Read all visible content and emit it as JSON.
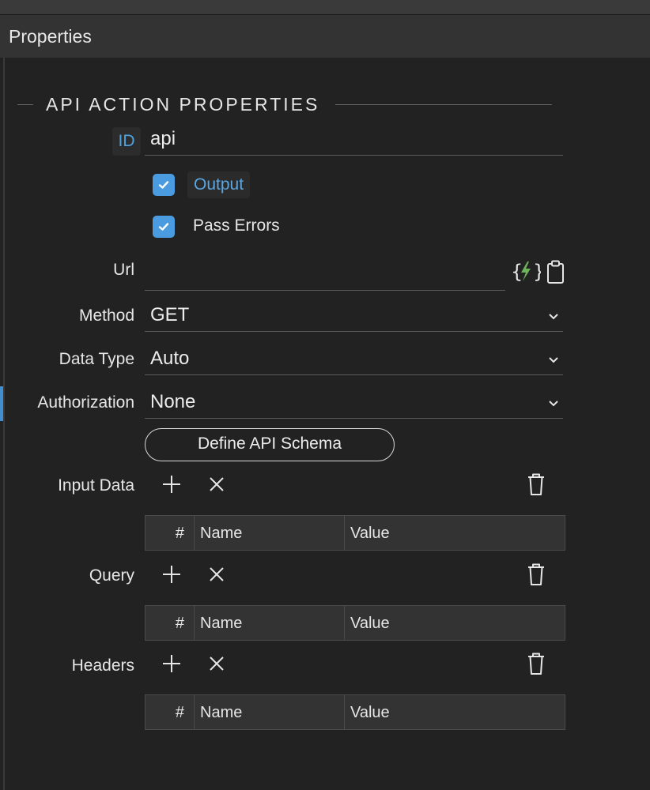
{
  "header": {
    "title": "Properties"
  },
  "section": {
    "title": "API ACTION PROPERTIES"
  },
  "id_field": {
    "badge": "ID",
    "value": "api"
  },
  "checkboxes": {
    "output": {
      "label": "Output",
      "checked": true
    },
    "pass_errors": {
      "label": "Pass Errors",
      "checked": true
    }
  },
  "url": {
    "label": "Url",
    "value": ""
  },
  "method": {
    "label": "Method",
    "value": "GET"
  },
  "data_type": {
    "label": "Data Type",
    "value": "Auto"
  },
  "authorization": {
    "label": "Authorization",
    "value": "None"
  },
  "define_schema_button": "Define API Schema",
  "grids": [
    {
      "label": "Input Data",
      "columns": [
        "#",
        "Name",
        "Value"
      ]
    },
    {
      "label": "Query",
      "columns": [
        "#",
        "Name",
        "Value"
      ]
    },
    {
      "label": "Headers",
      "columns": [
        "#",
        "Name",
        "Value"
      ]
    }
  ],
  "colors": {
    "accent": "#4a9be0",
    "dynamic_icon_green": "#6db35a",
    "background": "#222222"
  },
  "icons": {
    "url_dynamic": "dynamic-data-icon",
    "url_clipboard": "clipboard-icon",
    "add": "plus-icon",
    "remove": "close-icon",
    "delete": "trash-icon",
    "dropdown": "chevron-down-icon",
    "check": "checkmark-icon"
  }
}
